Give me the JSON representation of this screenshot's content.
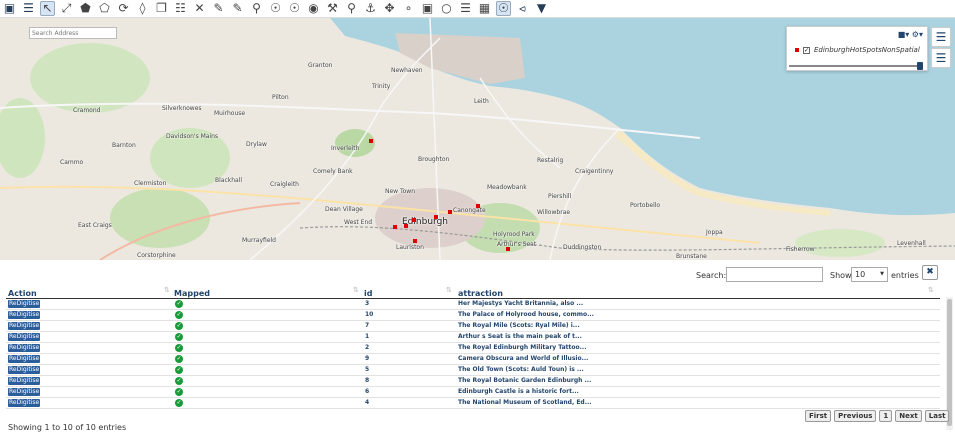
{
  "toolbar": {
    "icons": [
      "layers-icon",
      "stack-icon",
      "select-arrow-icon",
      "multi-select-icon",
      "draw-polygon-icon",
      "edit-polygon-icon",
      "rotate-icon",
      "split-icon",
      "copy-icon",
      "clipboard-icon",
      "delete-icon",
      "ruler-icon",
      "measure-area-icon",
      "zoom-box-icon",
      "globe-icon",
      "globe-alt-icon",
      "location-pin-icon",
      "tools-icon",
      "search-tool-icon",
      "anchor-icon",
      "pan-icon",
      "node-icon",
      "camera-icon",
      "circle-icon",
      "list-icon",
      "table-icon",
      "web-icon",
      "share-icon",
      "map-pin-icon"
    ]
  },
  "map": {
    "search_placeholder": "Search Address",
    "places": [
      {
        "name": "Granton"
      },
      {
        "name": "Newhaven"
      },
      {
        "name": "Trinity"
      },
      {
        "name": "Cramond"
      },
      {
        "name": "Silverknowes"
      },
      {
        "name": "Muirhouse"
      },
      {
        "name": "Pilton"
      },
      {
        "name": "Leith"
      },
      {
        "name": "Davidson's Mains"
      },
      {
        "name": "Barnton"
      },
      {
        "name": "Drylaw"
      },
      {
        "name": "Inverleith"
      },
      {
        "name": "Broughton"
      },
      {
        "name": "Restalrig"
      },
      {
        "name": "Craigentinny"
      },
      {
        "name": "Cammo"
      },
      {
        "name": "Blackhall"
      },
      {
        "name": "Clermiston"
      },
      {
        "name": "Craigleith"
      },
      {
        "name": "Comely Bank"
      },
      {
        "name": "New Town"
      },
      {
        "name": "Meadowbank"
      },
      {
        "name": "Piershill"
      },
      {
        "name": "Portobello"
      },
      {
        "name": "Dean Village"
      },
      {
        "name": "West End"
      },
      {
        "name": "Canongate"
      },
      {
        "name": "Willowbrae"
      },
      {
        "name": "East Craigs"
      },
      {
        "name": "Murrayfield"
      },
      {
        "name": "Edinburgh"
      },
      {
        "name": "Lauriston"
      },
      {
        "name": "Duddingston"
      },
      {
        "name": "Joppa"
      },
      {
        "name": "Fisherrow"
      },
      {
        "name": "Levenhall"
      },
      {
        "name": "Corstorphine"
      },
      {
        "name": "Brunstane"
      },
      {
        "name": "Holyrood Park"
      },
      {
        "name": "Arthur's Seat"
      }
    ],
    "layer_panel": {
      "layer_name": "EdinburghHotSpotsNonSpatial",
      "checked": true,
      "swatch_color": "#e00000",
      "opacity_percent": 100
    }
  },
  "table": {
    "search_label": "Search:",
    "search_value": "",
    "show_label": "Show",
    "show_value": "10",
    "entries_label": "entries",
    "columns": [
      "Action",
      "Mapped",
      "id",
      "attraction"
    ],
    "action_label": "ReDigitise",
    "rows": [
      {
        "id": "3",
        "attraction": "Her Majestys Yacht Britannia, also ..."
      },
      {
        "id": "10",
        "attraction": "The Palace of Holyrood house, commo..."
      },
      {
        "id": "7",
        "attraction": "The Royal Mile (Scots: Ryal Mile) i..."
      },
      {
        "id": "1",
        "attraction": "Arthur s Seat is the main peak of t..."
      },
      {
        "id": "2",
        "attraction": "The Royal Edinburgh Military Tattoo..."
      },
      {
        "id": "9",
        "attraction": "Camera Obscura and World of Illusio..."
      },
      {
        "id": "5",
        "attraction": "The Old Town (Scots: Auld Toun) is ..."
      },
      {
        "id": "8",
        "attraction": "The Royal Botanic Garden Edinburgh ..."
      },
      {
        "id": "6",
        "attraction": "Edinburgh Castle is a historic fort..."
      },
      {
        "id": "4",
        "attraction": "The National Museum of Scotland, Ed..."
      }
    ],
    "info": "Showing 1 to 10 of 10 entries",
    "pager": {
      "first": "First",
      "previous": "Previous",
      "page": "1",
      "next": "Next",
      "last": "Last"
    }
  }
}
